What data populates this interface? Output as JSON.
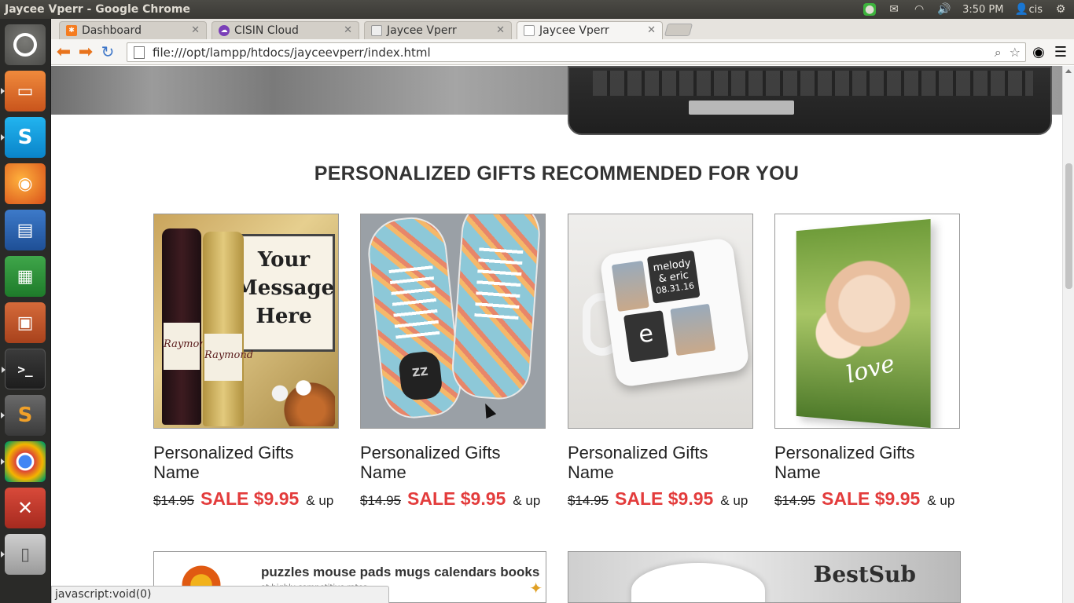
{
  "panel": {
    "window_title": "Jaycee Vperr - Google Chrome",
    "time": "3:50 PM",
    "user": "cis",
    "icons": [
      "messaging-icon",
      "mail-icon",
      "wifi-icon",
      "volume-icon",
      "user-icon",
      "gear-icon"
    ]
  },
  "launcher": {
    "items": [
      "dash-home",
      "files",
      "skype",
      "firefox",
      "libreoffice-writer",
      "libreoffice-calc",
      "libreoffice-impress",
      "terminal",
      "sublime-text",
      "google-chrome",
      "system-settings",
      "disk"
    ]
  },
  "browser": {
    "tabs": [
      {
        "label": "Dashboard",
        "favicon": "xampp-icon"
      },
      {
        "label": "CISIN Cloud",
        "favicon": "cloud-icon"
      },
      {
        "label": "Jaycee Vperr",
        "favicon": "page-icon"
      },
      {
        "label": "Jaycee Vperr",
        "favicon": "page-icon",
        "active": true
      }
    ],
    "url": "file:///opt/lampp/htdocs/jayceevperr/index.html",
    "status_text": "javascript:void(0)"
  },
  "page": {
    "section_title": "PERSONALIZED GIFTS RECOMMENDED FOR YOU",
    "products": [
      {
        "name": "Personalized Gifts Name",
        "old_price": "$14.95",
        "sale": "SALE $9.95",
        "suffix": "& up",
        "image": "wine-gift",
        "image_text": "Your Message Here",
        "label_text": "Raymond"
      },
      {
        "name": "Personalized Gifts Name",
        "old_price": "$14.95",
        "sale": "SALE $9.95",
        "suffix": "& up",
        "image": "sneakers",
        "insole_text": "ZZ"
      },
      {
        "name": "Personalized Gifts Name",
        "old_price": "$14.95",
        "sale": "SALE $9.95",
        "suffix": "& up",
        "image": "photo-mug",
        "mug_text_1": "melody & eric",
        "mug_text_2": "08.31.16",
        "mug_letter": "e"
      },
      {
        "name": "Personalized Gifts Name",
        "old_price": "$14.95",
        "sale": "SALE $9.95",
        "suffix": "& up",
        "image": "canvas-print",
        "overlay_text": "love"
      }
    ],
    "banner_left": {
      "text": "puzzles mouse pads mugs calendars books",
      "sub": "at highly competitive rates."
    },
    "banner_right": {
      "brand": "BestSub"
    }
  }
}
